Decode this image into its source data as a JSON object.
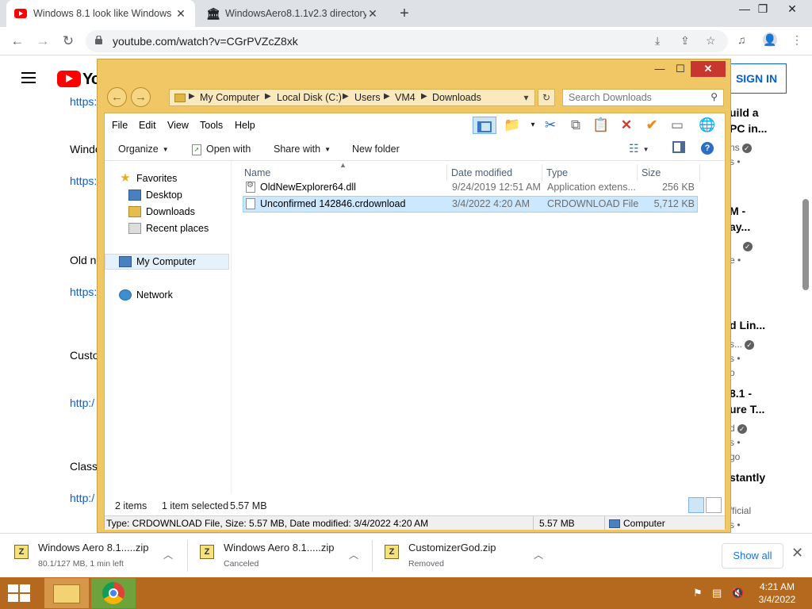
{
  "browser": {
    "tabs": [
      {
        "title": "Windows 8.1 look like Windows"
      },
      {
        "title": "WindowsAero8.1.1v2.3 directory"
      }
    ],
    "url": "youtube.com/watch?v=CGrPVZcZ8xk"
  },
  "youtube": {
    "logo_text": "You",
    "signin_label": "SIGN IN",
    "description_lines": [
      "https:",
      "Windo",
      "https:",
      "Old ne",
      "https:",
      "Custo",
      "http:/",
      "Class",
      "http:/"
    ],
    "sidebar_fragments": [
      "uild a",
      "PC in...",
      "ns",
      "s •",
      "M -",
      "ay...",
      "l",
      "e •",
      "d Lin...",
      "s...",
      "s •",
      "o",
      "8.1 -",
      "ure T...",
      "d",
      "s •",
      "go",
      "stantly",
      "fficial",
      "s •"
    ]
  },
  "explorer": {
    "breadcrumbs": [
      "My Computer",
      "Local Disk (C:)",
      "Users",
      "VM4",
      "Downloads"
    ],
    "search_placeholder": "Search Downloads",
    "menu": [
      "File",
      "Edit",
      "View",
      "Tools",
      "Help"
    ],
    "commands": {
      "organize": "Organize",
      "open_with": "Open with",
      "share_with": "Share with",
      "new_folder": "New folder"
    },
    "nav": {
      "favorites": "Favorites",
      "desktop": "Desktop",
      "downloads": "Downloads",
      "recent": "Recent places",
      "computer": "My Computer",
      "network": "Network"
    },
    "columns": {
      "name": "Name",
      "date": "Date modified",
      "type": "Type",
      "size": "Size"
    },
    "files": [
      {
        "name": "OldNewExplorer64.dll",
        "date": "9/24/2019 12:51 AM",
        "type": "Application extens...",
        "size": "256 KB"
      },
      {
        "name": "Unconfirmed 142846.crdownload",
        "date": "3/4/2022 4:20 AM",
        "type": "CRDOWNLOAD File",
        "size": "5,712 KB"
      }
    ],
    "status": {
      "items": "2 items",
      "selected": "1 item selected",
      "selected_size": "5.57 MB"
    },
    "details": {
      "info": "Type: CRDOWNLOAD File, Size: 5.57 MB, Date modified: 3/4/2022 4:20 AM",
      "size": "5.57 MB",
      "location": "Computer"
    }
  },
  "downloads": {
    "items": [
      {
        "name": "Windows Aero 8.1.....zip",
        "status": "80.1/127 MB, 1 min left"
      },
      {
        "name": "Windows Aero 8.1.....zip",
        "status": "Canceled"
      },
      {
        "name": "CustomizerGod.zip",
        "status": "Removed"
      }
    ],
    "show_all": "Show all"
  },
  "taskbar": {
    "time": "4:21 AM",
    "date": "3/4/2022"
  }
}
